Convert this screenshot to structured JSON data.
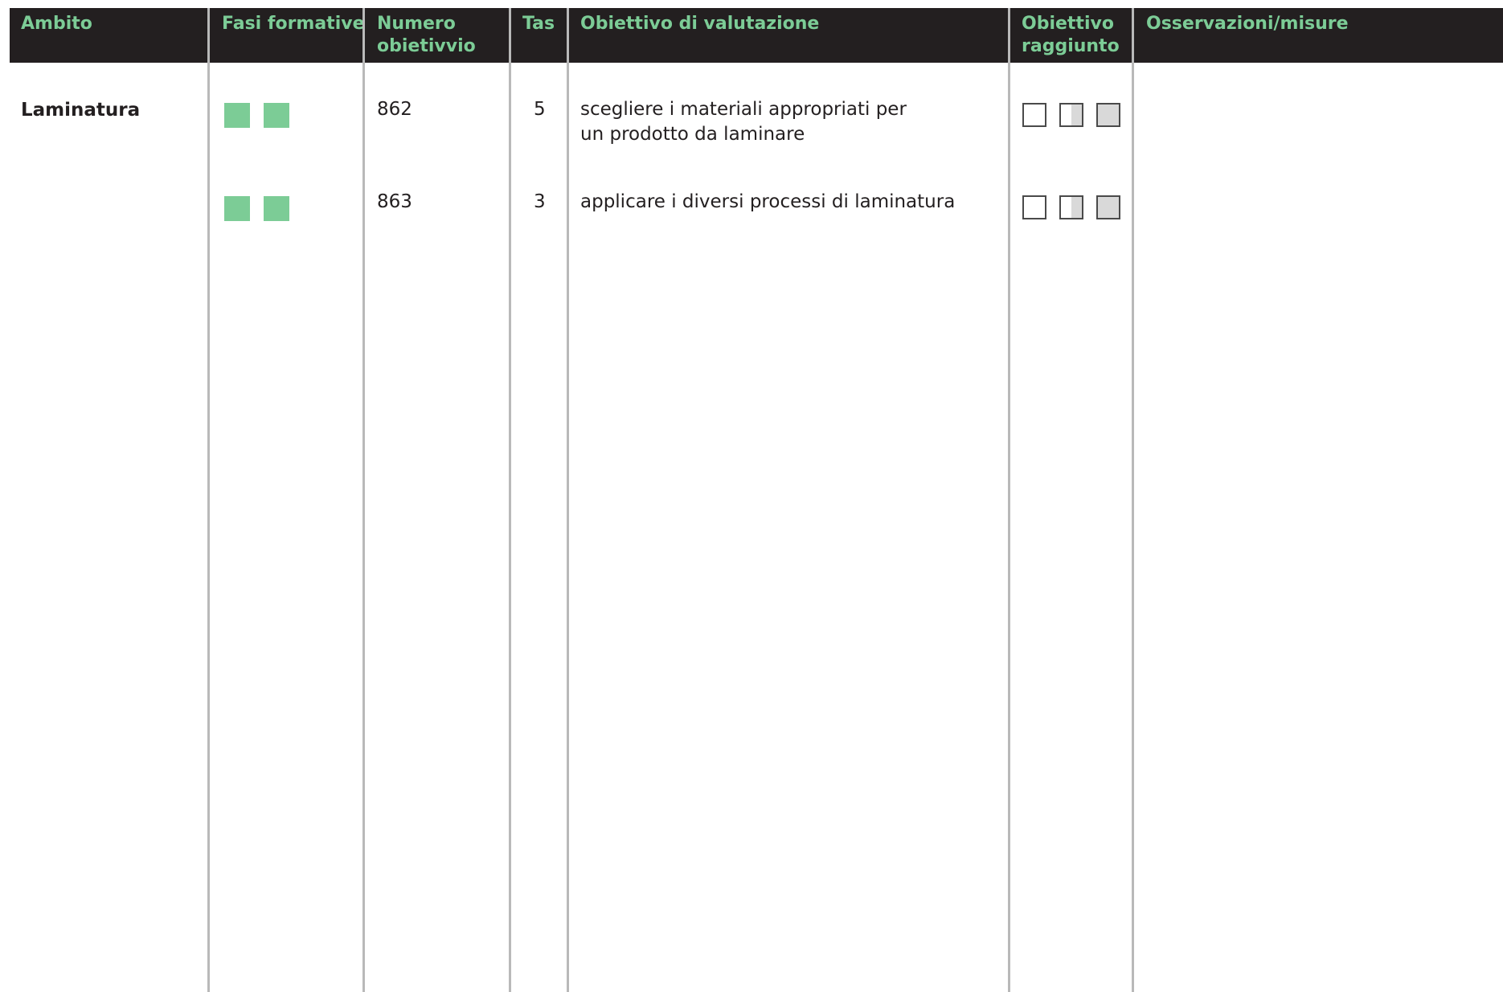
{
  "colors": {
    "header_bg": "#231f20",
    "header_text": "#7ccc96",
    "phase_square": "#7ccc96",
    "check_fill": "#d9d9d9"
  },
  "headers": {
    "ambito": "Ambito",
    "fasi": "Fasi formative",
    "numero_1": "Numero",
    "numero_2": "obietivvio",
    "tas": "Tas",
    "obiettivo": "Obiettivo di valutazione",
    "raggiunto_1": "Obiettivo",
    "raggiunto_2": "raggiunto",
    "osservazioni": "Osservazioni/misure"
  },
  "ambito": "Laminatura",
  "rows": [
    {
      "numero": "862",
      "tas": "5",
      "obiettivo_1": "scegliere i materiali appropriati per",
      "obiettivo_2": "un prodotto da laminare",
      "phases": 2,
      "checkboxes": [
        "empty",
        "half",
        "full"
      ]
    },
    {
      "numero": "863",
      "tas": "3",
      "obiettivo_1": "applicare i diversi processi di laminatura",
      "obiettivo_2": "",
      "phases": 2,
      "checkboxes": [
        "empty",
        "half",
        "full"
      ]
    }
  ]
}
